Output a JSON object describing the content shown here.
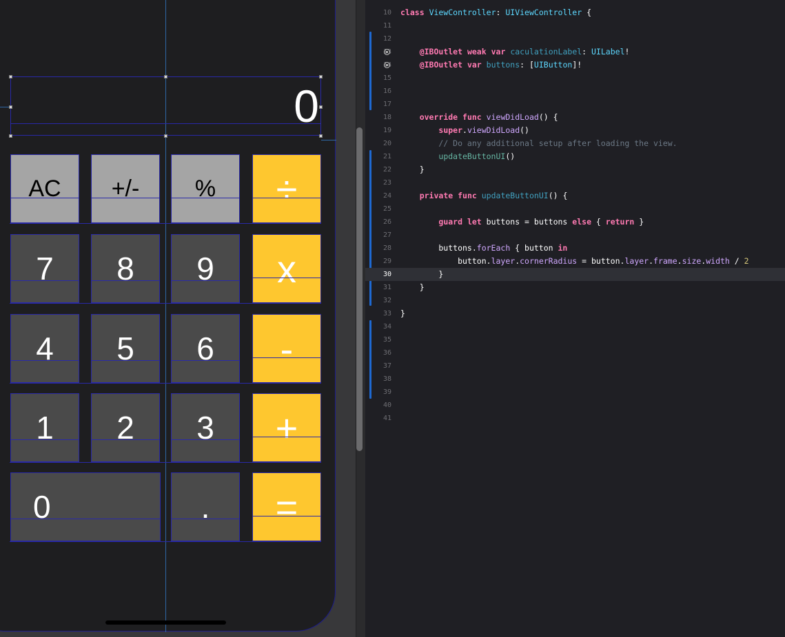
{
  "calculator": {
    "display_value": "0",
    "rows": [
      [
        {
          "label": "AC",
          "kind": "func"
        },
        {
          "label": "+/-",
          "kind": "func"
        },
        {
          "label": "%",
          "kind": "func"
        },
        {
          "label": "÷",
          "kind": "op"
        }
      ],
      [
        {
          "label": "7",
          "kind": "num"
        },
        {
          "label": "8",
          "kind": "num"
        },
        {
          "label": "9",
          "kind": "num"
        },
        {
          "label": "x",
          "kind": "op"
        }
      ],
      [
        {
          "label": "4",
          "kind": "num"
        },
        {
          "label": "5",
          "kind": "num"
        },
        {
          "label": "6",
          "kind": "num"
        },
        {
          "label": "-",
          "kind": "op"
        }
      ],
      [
        {
          "label": "1",
          "kind": "num"
        },
        {
          "label": "2",
          "kind": "num"
        },
        {
          "label": "3",
          "kind": "num"
        },
        {
          "label": "+",
          "kind": "op"
        }
      ],
      [
        {
          "label": "0",
          "kind": "num"
        },
        {
          "label": ".",
          "kind": "num"
        },
        {
          "label": "=",
          "kind": "op"
        }
      ]
    ],
    "colors": {
      "func": "#a5a5a5",
      "num": "#4a4a4a",
      "op": "#fec72f"
    }
  },
  "editor": {
    "current_line": 30,
    "outlet_lines": [
      13,
      14
    ],
    "lines": [
      {
        "n": 10,
        "text": "class ViewController: UIViewController {"
      },
      {
        "n": 11,
        "text": ""
      },
      {
        "n": 12,
        "text": ""
      },
      {
        "n": 13,
        "text": "    @IBOutlet weak var caculationLabel: UILabel!"
      },
      {
        "n": 14,
        "text": "    @IBOutlet var buttons: [UIButton]!"
      },
      {
        "n": 15,
        "text": ""
      },
      {
        "n": 16,
        "text": ""
      },
      {
        "n": 17,
        "text": ""
      },
      {
        "n": 18,
        "text": "    override func viewDidLoad() {"
      },
      {
        "n": 19,
        "text": "        super.viewDidLoad()"
      },
      {
        "n": 20,
        "text": "        // Do any additional setup after loading the view."
      },
      {
        "n": 21,
        "text": "        updateButtonUI()"
      },
      {
        "n": 22,
        "text": "    }"
      },
      {
        "n": 23,
        "text": ""
      },
      {
        "n": 24,
        "text": "    private func updateButtonUI() {"
      },
      {
        "n": 25,
        "text": ""
      },
      {
        "n": 26,
        "text": "        guard let buttons = buttons else { return }"
      },
      {
        "n": 27,
        "text": ""
      },
      {
        "n": 28,
        "text": "        buttons.forEach { button in"
      },
      {
        "n": 29,
        "text": "            button.layer.cornerRadius = button.layer.frame.size.width / 2"
      },
      {
        "n": 30,
        "text": "        }"
      },
      {
        "n": 31,
        "text": "    }"
      },
      {
        "n": 32,
        "text": ""
      },
      {
        "n": 33,
        "text": "}"
      },
      {
        "n": 34,
        "text": ""
      },
      {
        "n": 35,
        "text": ""
      },
      {
        "n": 36,
        "text": ""
      },
      {
        "n": 37,
        "text": ""
      },
      {
        "n": 38,
        "text": ""
      },
      {
        "n": 39,
        "text": ""
      },
      {
        "n": 40,
        "text": ""
      },
      {
        "n": 41,
        "text": ""
      }
    ]
  }
}
